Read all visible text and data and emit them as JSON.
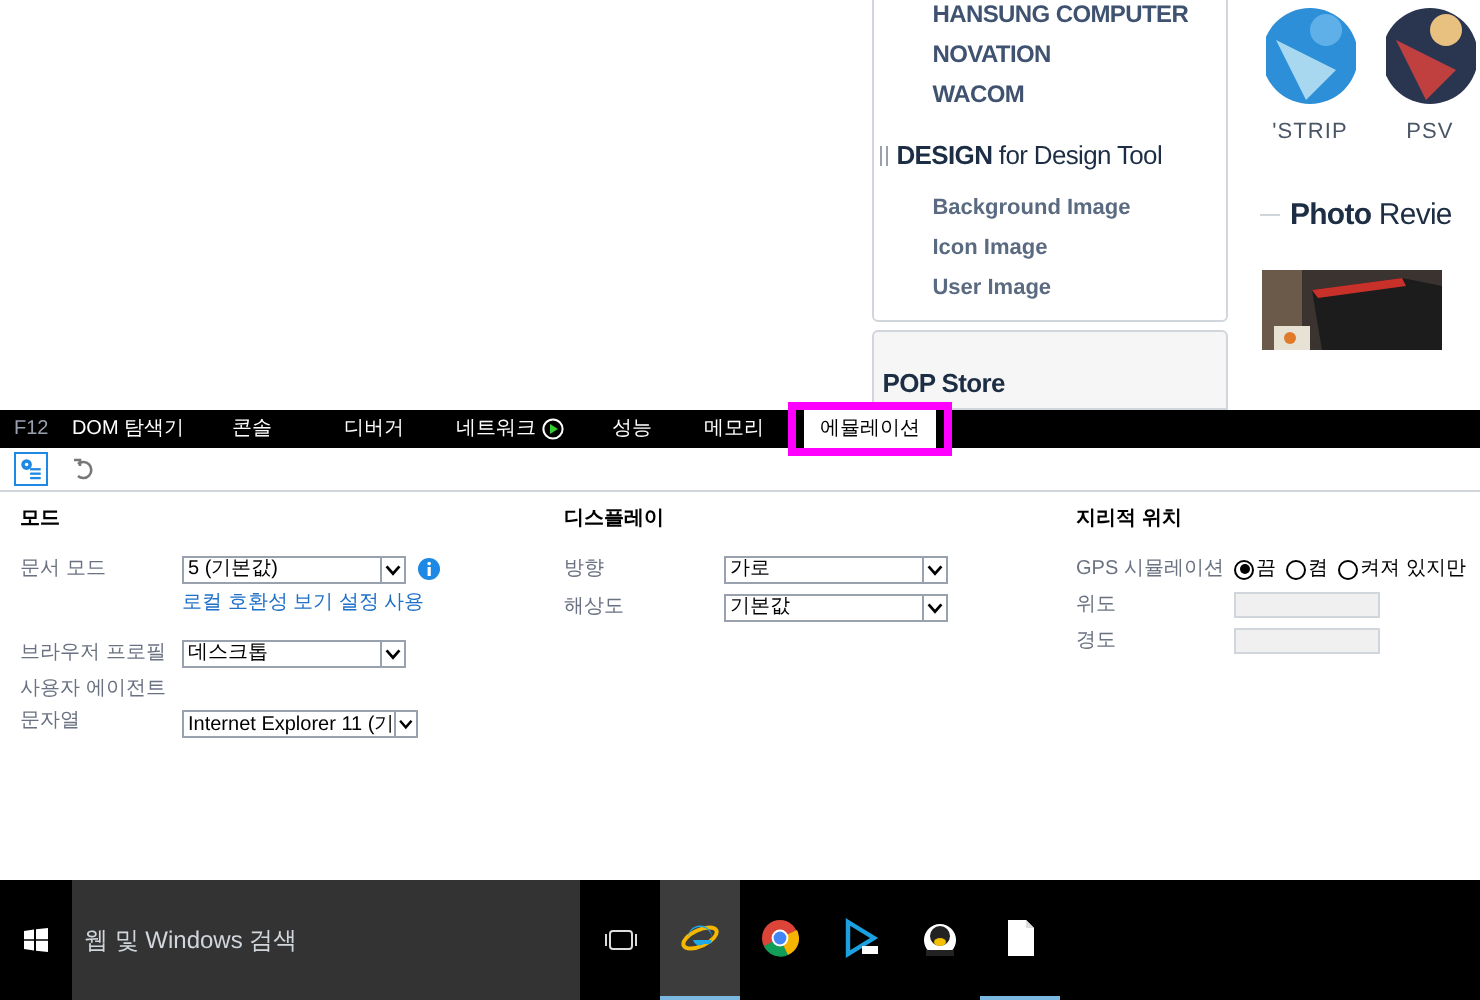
{
  "web_page": {
    "sidebar": {
      "brands": [
        "HANSUNG COMPUTER",
        "NOVATION",
        "WACOM"
      ],
      "design_heading": "**DESIGN** for Design Tool",
      "design_items": [
        "Background Image",
        "Icon Image",
        "User Image"
      ],
      "pop_heading": "POP Store"
    },
    "thumbnails": [
      {
        "caption": "'STRIP"
      },
      {
        "caption": "PSV"
      }
    ],
    "photo_review": "**Photo** Revie"
  },
  "devtools": {
    "f12": "F12",
    "tabs": [
      {
        "label": "DOM 탐색기",
        "selected": false,
        "kind": "plain"
      },
      {
        "label": "콘솔",
        "selected": false,
        "kind": "plain"
      },
      {
        "label": "디버거",
        "selected": false,
        "kind": "plain"
      },
      {
        "label": "네트워크",
        "selected": false,
        "kind": "network"
      },
      {
        "label": "성능",
        "selected": false,
        "kind": "plain"
      },
      {
        "label": "메모리",
        "selected": false,
        "kind": "plain"
      },
      {
        "label": "에뮬레이션",
        "selected": true,
        "kind": "plain",
        "highlighted": true
      }
    ],
    "mode": {
      "title": "모드",
      "document_mode": {
        "label": "문서 모드",
        "value": "5 (기본값)"
      },
      "link": "로컬 호환성 보기 설정 사용",
      "browser_profile": {
        "label": "브라우저 프로필",
        "value": "데스크톱"
      },
      "user_agent": {
        "label": "사용자 에이전트 문자열",
        "value": "Internet Explorer 11 (기"
      }
    },
    "display": {
      "title": "디스플레이",
      "fields": [
        {
          "label": "방향",
          "value": "가로"
        },
        {
          "label": "해상도",
          "value": "기본값"
        }
      ]
    },
    "geolocation": {
      "title": "지리적 위치",
      "gps_label": "GPS 시뮬레이션",
      "options": [
        {
          "label": "끔",
          "selected": true
        },
        {
          "label": "켬",
          "selected": false
        },
        {
          "label": "켜져 있지만",
          "selected": false
        }
      ],
      "fields": [
        {
          "label": "위도"
        },
        {
          "label": "경도"
        }
      ]
    }
  },
  "taskbar": {
    "search": {
      "placeholder": "웹 및 Windows 검색"
    },
    "apps": [
      {
        "kind": "ie",
        "active": true,
        "running": true
      },
      {
        "kind": "chrome",
        "active": false,
        "running": false
      },
      {
        "kind": "player",
        "active": false,
        "running": false
      },
      {
        "kind": "penguin",
        "active": false,
        "running": false
      },
      {
        "kind": "file",
        "active": false,
        "running": true
      }
    ]
  }
}
